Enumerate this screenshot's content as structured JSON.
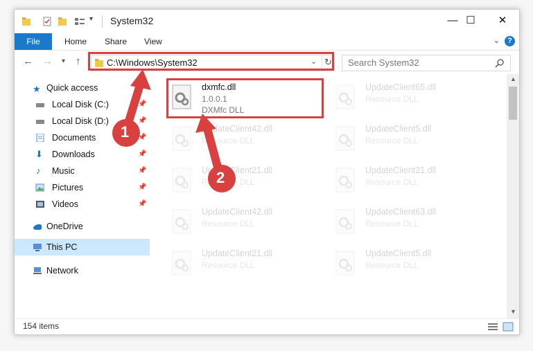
{
  "window": {
    "title": "System32"
  },
  "ribbon": {
    "file_tab": "File",
    "tabs": [
      "Home",
      "Share",
      "View"
    ],
    "help": "?"
  },
  "window_controls": {
    "minimize": "—",
    "maximize": "☐",
    "close": "✕"
  },
  "address": {
    "path": "C:\\Windows\\System32"
  },
  "search": {
    "placeholder": "Search System32"
  },
  "nav": {
    "quick_access": "Quick access",
    "items": [
      {
        "label": "Local Disk (C:)",
        "icon": "drive-icon",
        "pinned": true
      },
      {
        "label": "Local Disk (D:)",
        "icon": "drive-icon",
        "pinned": true
      },
      {
        "label": "Documents",
        "icon": "documents-icon",
        "pinned": true
      },
      {
        "label": "Downloads",
        "icon": "downloads-icon",
        "pinned": true
      },
      {
        "label": "Music",
        "icon": "music-icon",
        "pinned": true
      },
      {
        "label": "Pictures",
        "icon": "pictures-icon",
        "pinned": true
      },
      {
        "label": "Videos",
        "icon": "videos-icon",
        "pinned": true
      }
    ],
    "onedrive": "OneDrive",
    "this_pc": "This PC",
    "network": "Network"
  },
  "files": {
    "highlighted": {
      "name": "dxmfc.dll",
      "version": "1.0.0.1",
      "description": "DXMfc DLL"
    },
    "col1": [
      {
        "name": "UpdateClient42.dll",
        "type": "Resource DLL"
      },
      {
        "name": "UpdateClient21.dll",
        "type": "Resource DLL"
      },
      {
        "name": "UpdateClient42.dll",
        "type": "Resource DLL"
      },
      {
        "name": "UpdateClient21.dll",
        "type": "Resource DLL"
      }
    ],
    "col2": [
      {
        "name": "UpdateClient65.dll",
        "type": "Resource DLL"
      },
      {
        "name": "UpdateClient5.dll",
        "type": "Resource DLL"
      },
      {
        "name": "UpdateClient21.dll",
        "type": "Resource DLL"
      },
      {
        "name": "UpdateClient63.dll",
        "type": "Resource DLL"
      },
      {
        "name": "UpdateClient5.dll",
        "type": "Resource DLL"
      }
    ]
  },
  "status": {
    "item_count": "154 items"
  },
  "annotations": {
    "step1": "1",
    "step2": "2",
    "color": "#d94040"
  }
}
